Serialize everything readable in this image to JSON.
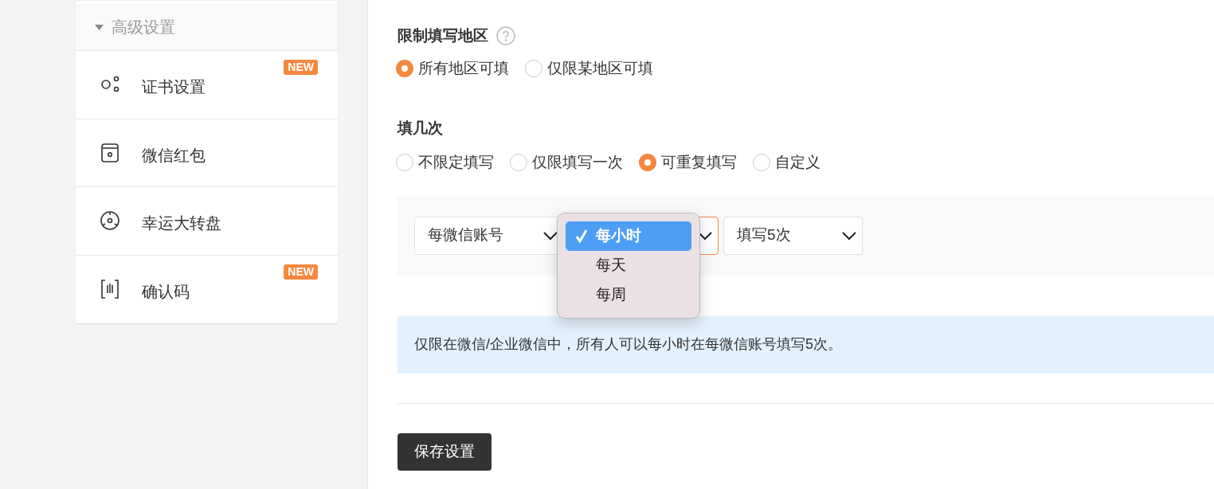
{
  "sidebar": {
    "section": {
      "label": "高级设置",
      "expanded": true
    },
    "items": [
      {
        "label": "证书设置",
        "kind": "nodes",
        "badge": "NEW"
      },
      {
        "label": "微信红包",
        "kind": "envelope"
      },
      {
        "label": "幸运大转盘",
        "kind": "wheel"
      },
      {
        "label": "确认码",
        "kind": "code",
        "badge": "NEW"
      }
    ]
  },
  "region": {
    "title": "限制填写地区",
    "options": [
      {
        "label": "所有地区可填",
        "selected": true
      },
      {
        "label": "仅限某地区可填",
        "selected": false
      }
    ]
  },
  "times": {
    "title": "填几次",
    "options": [
      {
        "label": "不限定填写",
        "selected": false
      },
      {
        "label": "仅限填写一次",
        "selected": false
      },
      {
        "label": "可重复填写",
        "selected": true
      },
      {
        "label": "自定义",
        "selected": false
      }
    ]
  },
  "limits": {
    "selects": [
      {
        "value": "每微信账号",
        "focused": false
      },
      {
        "focused": true,
        "menu": [
          {
            "label": "每小时",
            "selected": true
          },
          {
            "label": "每天",
            "selected": false
          },
          {
            "label": "每周",
            "selected": false
          }
        ]
      },
      {
        "value": "填写5次",
        "focused": false
      }
    ]
  },
  "summary": "仅限在微信/企业微信中，所有人可以每小时在每微信账号填写5次。",
  "save_button": "保存设置"
}
